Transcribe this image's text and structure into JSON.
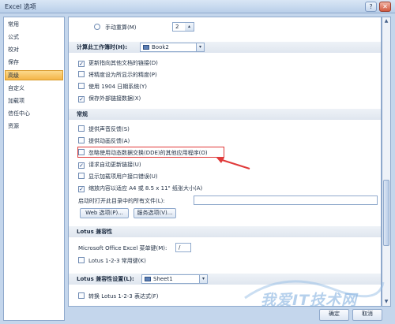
{
  "window": {
    "title": "Excel 选项",
    "help": "?",
    "close": "✕"
  },
  "sidebar": {
    "items": [
      {
        "label": "常用"
      },
      {
        "label": "公式"
      },
      {
        "label": "校对"
      },
      {
        "label": "保存"
      },
      {
        "label": "高级"
      },
      {
        "label": "自定义"
      },
      {
        "label": "加载项"
      },
      {
        "label": "信任中心"
      },
      {
        "label": "资源"
      }
    ],
    "active": "高级"
  },
  "calc": {
    "manual_label": "手动重算(M)",
    "manual_value": "2",
    "workbook_label": "计算此工作簿时(H):",
    "workbook_value": "Book2",
    "options": [
      {
        "label": "更新指向其他文档的链接(D)",
        "checked": true
      },
      {
        "label": "将精度设为所显示的精度(P)",
        "checked": false
      },
      {
        "label": "使用 1904 日期系统(Y)",
        "checked": false
      },
      {
        "label": "保存外部链接数据(X)",
        "checked": true
      }
    ]
  },
  "general": {
    "header": "常规",
    "options": [
      {
        "label": "提供声音反馈(S)",
        "checked": false
      },
      {
        "label": "提供动画反馈(A)",
        "checked": false
      },
      {
        "label": "忽略使用动态数据交换(DDE)的其他应用程序(O)",
        "checked": false
      },
      {
        "label": "请求自动更新链接(U)",
        "checked": true
      },
      {
        "label": "显示加载项用户接口错误(U)",
        "checked": false
      },
      {
        "label": "缩放内容以适应 A4 或 8.5 x 11\" 纸张大小(A)",
        "checked": true
      }
    ],
    "startup_label": "启动时打开此目录中的所有文件(L):",
    "startup_value": "",
    "web_options_label": "Web 选项(P)...",
    "service_options_label": "服务选项(V)..."
  },
  "lotus": {
    "header": "Lotus 兼容性",
    "menu_key_label": "Microsoft Office Excel 菜单键(M):",
    "menu_key_value": "/",
    "nav_keys_label": "Lotus 1-2-3 常用键(K)",
    "nav_keys_checked": false
  },
  "lotus_settings": {
    "header": "Lotus 兼容性设置(L):",
    "sheet_value": "Sheet1",
    "formula_label": "转换 Lotus 1-2-3 表达式(F)",
    "formula_checked": false
  },
  "footer": {
    "ok_label": "确定",
    "cancel_label": "取消"
  },
  "watermark": {
    "text": "我爱IT技术网"
  },
  "colors": {
    "highlight": "#e03a3a",
    "active_item": "#f4b548"
  }
}
